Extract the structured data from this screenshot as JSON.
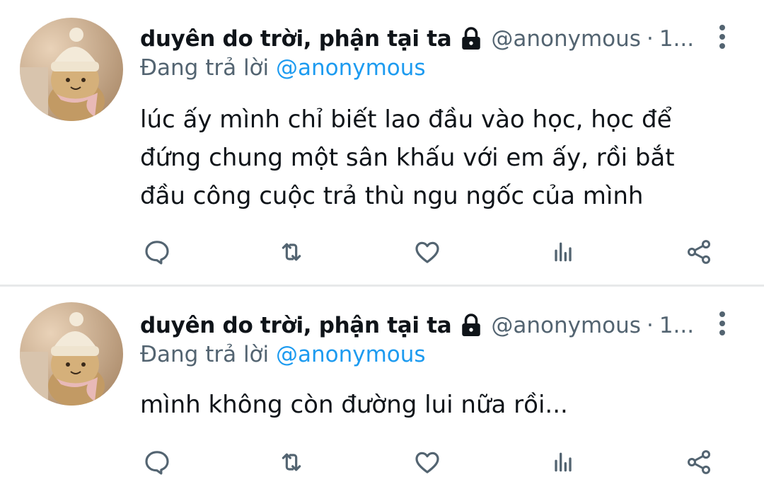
{
  "tweets": [
    {
      "display_name": "duyên do trời, phận tại ta",
      "handle": "@anonymous",
      "separator": "·",
      "time": "1...",
      "replying_prefix": "Đang trả lời",
      "replying_to": "@anonymous",
      "text": "lúc ấy mình chỉ biết lao đầu vào học, học để đứng chung một sân khấu với em ấy, rồi bắt đầu công cuộc trả thù ngu ngốc của mình",
      "icons": [
        "lock-icon",
        "more-vertical-icon",
        "reply-icon",
        "retweet-icon",
        "like-icon",
        "views-icon",
        "share-icon"
      ]
    },
    {
      "display_name": "duyên do trời, phận tại ta",
      "handle": "@anonymous",
      "separator": "·",
      "time": "1...",
      "replying_prefix": "Đang trả lời",
      "replying_to": "@anonymous",
      "text": "mình không còn đường lui nữa rồi...",
      "icons": [
        "lock-icon",
        "more-vertical-icon",
        "reply-icon",
        "retweet-icon",
        "like-icon",
        "views-icon",
        "share-icon"
      ]
    }
  ],
  "colors": {
    "text_primary": "#0f1419",
    "text_secondary": "#536471",
    "accent": "#1d9bf0",
    "divider": "#e7e9ea"
  }
}
